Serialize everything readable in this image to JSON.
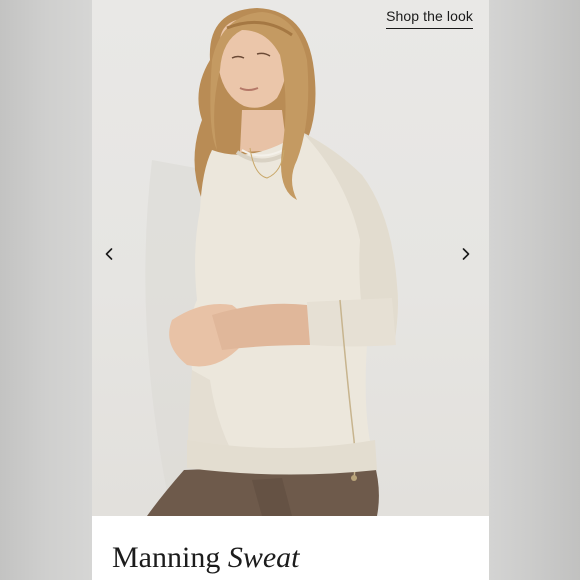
{
  "header": {
    "shop_link_label": "Shop the look"
  },
  "gallery": {
    "prev_icon": "chevron-left-icon",
    "next_icon": "chevron-right-icon"
  },
  "product": {
    "name_regular": "Manning",
    "name_italic": "Sweat"
  },
  "colors": {
    "text": "#1a1a1a",
    "sweater": "#ece7dc",
    "pants": "#6e5a4b",
    "hair": "#b98c55",
    "backdrop": "#e7e6e3"
  }
}
